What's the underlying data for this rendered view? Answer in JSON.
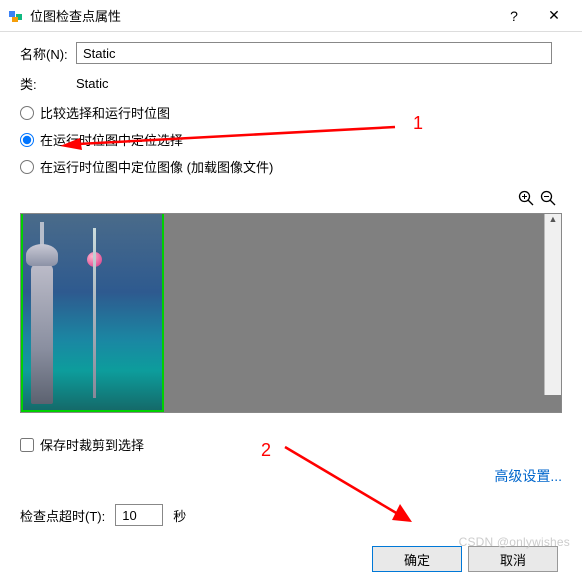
{
  "titlebar": {
    "title": "位图检查点属性",
    "help": "?",
    "close": "✕"
  },
  "labels": {
    "name": "名称(N):",
    "type": "类:",
    "timeout_label": "检查点超时(T):",
    "seconds": "秒",
    "save_crop": "保存时裁剪到选择"
  },
  "fields": {
    "name_value": "Static",
    "type_value": "Static",
    "timeout_value": "10"
  },
  "radios": {
    "opt1": "比较选择和运行时位图",
    "opt2": "在运行时位图中定位选择",
    "opt3": "在运行时位图中定位图像 (加载图像文件)",
    "selected": "opt2"
  },
  "zoom": {
    "in": "🔍",
    "out": "🔍"
  },
  "links": {
    "advanced": "高级设置..."
  },
  "buttons": {
    "ok": "确定",
    "cancel": "取消"
  },
  "annotations": {
    "n1": "1",
    "n2": "2"
  },
  "watermark": "CSDN @onlywishes"
}
